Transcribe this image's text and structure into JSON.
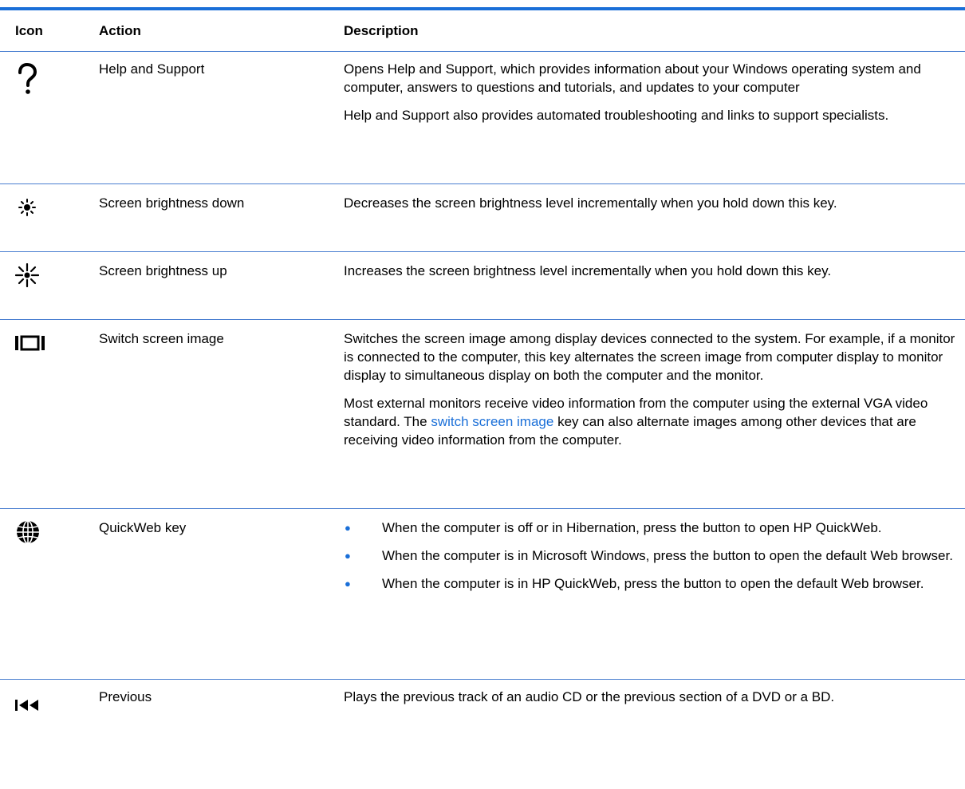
{
  "table": {
    "headers": {
      "icon": "Icon",
      "action": "Action",
      "description": "Description"
    },
    "rows": [
      {
        "icon": "question-mark-icon",
        "action": "Help and Support",
        "paragraphs": [
          "Opens Help and Support, which provides information about your Windows operating system and computer, answers to questions and tutorials, and updates to your computer",
          "Help and Support also provides automated troubleshooting and links to support specialists."
        ]
      },
      {
        "icon": "brightness-down-icon",
        "action": "Screen brightness down",
        "paragraphs": [
          "Decreases the screen brightness level incrementally when you hold down this key."
        ]
      },
      {
        "icon": "brightness-up-icon",
        "action": "Screen brightness up",
        "paragraphs": [
          "Increases the screen brightness level incrementally when you hold down this key."
        ]
      },
      {
        "icon": "switch-screen-icon",
        "action": "Switch screen image",
        "paragraphs": [
          "Switches the screen image among display devices connected to the system. For example, if a monitor is connected to the computer, this key alternates the screen image from computer display to monitor display to simultaneous display on both the computer and the monitor."
        ],
        "para2": {
          "before": "Most external monitors receive video information from the computer using the external VGA video standard. The ",
          "link": "switch screen image",
          "after": " key can also alternate images among other devices that are receiving video information from the computer."
        }
      },
      {
        "icon": "globe-icon",
        "action": "QuickWeb key",
        "bullets": [
          "When the computer is off or in Hibernation, press the button to open HP QuickWeb.",
          "When the computer is in Microsoft Windows, press the button to open the default Web browser.",
          "When the computer is in HP QuickWeb, press the button to open the default Web browser."
        ],
        "bullet_char": "●"
      },
      {
        "icon": "previous-track-icon",
        "action": "Previous",
        "paragraphs": [
          "Plays the previous track of an audio CD or the previous section of a DVD or a BD."
        ]
      }
    ]
  },
  "colors": {
    "accent": "#1a6fd8",
    "rule": "#4a7fd0",
    "text": "#000000"
  }
}
